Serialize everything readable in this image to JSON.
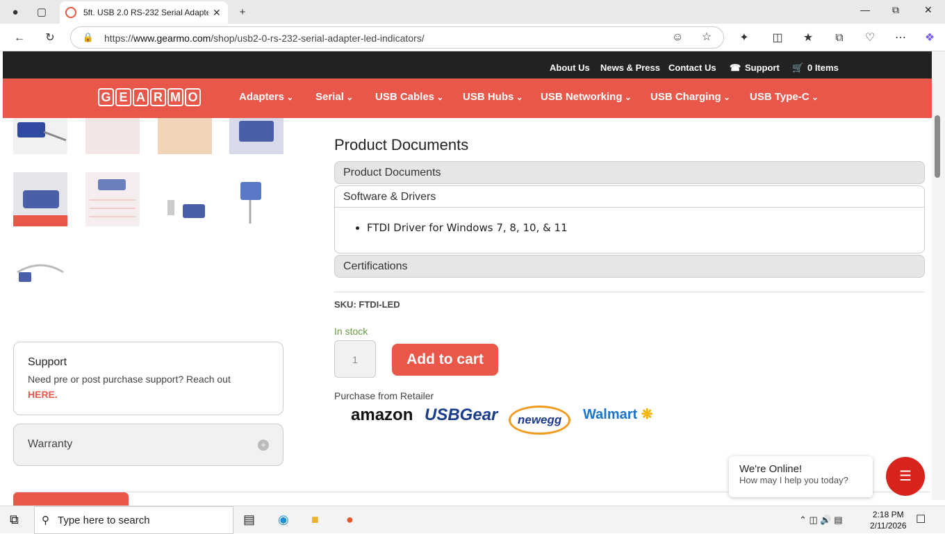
{
  "browser": {
    "tab_title": "5ft. USB 2.0 RS-232 Serial Adapter",
    "url_prefix": "https://",
    "url_host": "www.gearmo.com",
    "url_path": "/shop/usb2-0-rs-232-serial-adapter-led-indicators/"
  },
  "topbar": {
    "links": [
      "About Us",
      "News & Press",
      "Contact Us",
      "Support",
      "0 Items"
    ]
  },
  "nav": {
    "logo": "GEARMO",
    "items": [
      "Adapters",
      "Serial",
      "USB Cables",
      "USB Hubs",
      "USB Networking",
      "USB Charging",
      "USB Type-C"
    ]
  },
  "product": {
    "docs_title": "Product Documents",
    "accordion": [
      "Product Documents",
      "Software & Drivers",
      "Certifications"
    ],
    "drivers": [
      "FTDI Driver for Windows 7, 8, 10, & 11"
    ],
    "sku": "SKU: FTDI-LED",
    "stock": "In stock",
    "qty": "1",
    "cart": "Add to cart",
    "purchase": "Purchase from Retailer",
    "retailers": [
      "amazon",
      "USBGear",
      "newegg",
      "Walmart"
    ]
  },
  "sidebar": {
    "support_title": "Support",
    "support_text": "Need pre or post purchase support? Reach out",
    "support_link": "HERE.",
    "warranty": "Warranty"
  },
  "chat": {
    "title": "We're Online!",
    "subtitle": "How may I help you today?"
  },
  "taskbar": {
    "search": "Type here to search",
    "time": "2:18 PM",
    "date": "2/11/2026"
  },
  "colors": {
    "brand": "#e8574a",
    "topbar": "#222222"
  }
}
